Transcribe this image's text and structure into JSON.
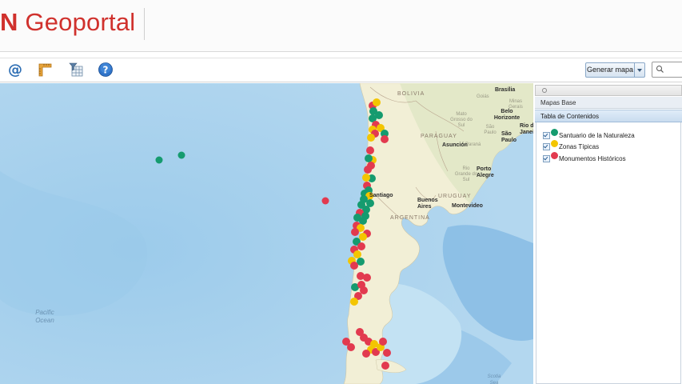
{
  "header": {
    "logo_initial": "N",
    "logo_text": "Geoportal",
    "logo_color": "#d0312d"
  },
  "toolbar": {
    "tools": [
      {
        "icon": "at-sign-icon"
      },
      {
        "icon": "ruler-icon"
      },
      {
        "icon": "filter-table-icon"
      },
      {
        "icon": "help-icon"
      }
    ],
    "generate_map_label": "Generar mapa"
  },
  "map": {
    "country_labels": [
      "BOLIVIA",
      "PARAGUAY",
      "URUGUAY",
      "ARGENTINA"
    ],
    "city_labels": [
      "Brasília",
      "Belo Horizonte",
      "Rio de Janeiro",
      "São Paulo",
      "Asunción",
      "Porto Alegre",
      "Buenos Aires",
      "Montevideo",
      "Santiago"
    ],
    "region_labels": [
      "Goiás",
      "Minas Gerais",
      "Mato Grosso do Sul",
      "São Paulo",
      "Paraná",
      "Rio Grande do Sul"
    ],
    "ocean_labels": [
      "Pacific Ocean",
      "Scotia Sea"
    ],
    "colors": {
      "ocean": "#a9d0ec",
      "land": "#f2efd6",
      "santuario": "#159b6f",
      "zonas": "#f3c500",
      "monumentos": "#e23a4f"
    }
  },
  "panel": {
    "header_icon": "plus-icon",
    "tab_base_maps": "Mapas Base",
    "tab_contents": "Tabla de Contenidos",
    "layers": [
      {
        "label": "Santuario de la Naturaleza",
        "color": "#159b6f",
        "checked": true
      },
      {
        "label": "Zonas Típicas",
        "color": "#f3c500",
        "checked": true
      },
      {
        "label": "Monumentos Históricos",
        "color": "#e23a4f",
        "checked": true
      }
    ]
  }
}
